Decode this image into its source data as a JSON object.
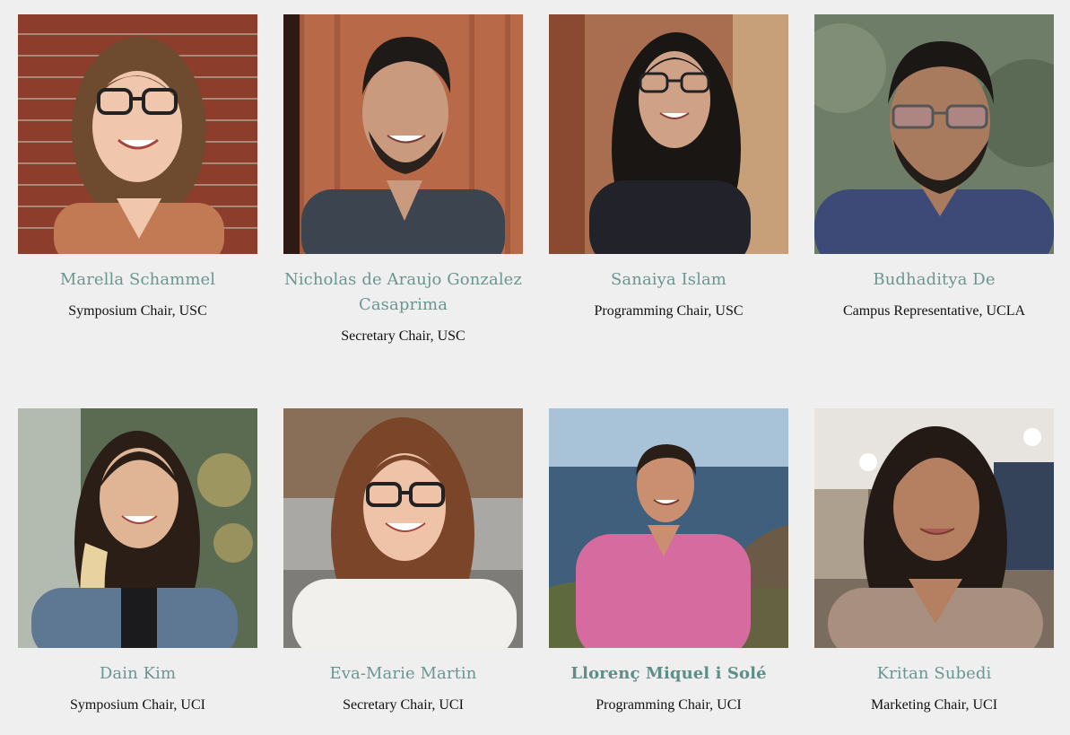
{
  "team": [
    {
      "name": "Marella Schammel",
      "role": "Symposium Chair, USC",
      "photo": "portrait-photo",
      "bg": "#8c3d2c",
      "shirt": "#c27a55",
      "hair": "#6e4a2e",
      "skin": "#f0c6ad"
    },
    {
      "name": "Nicholas de Araujo Gonzalez Casaprima",
      "role": "Secretary Chair, USC",
      "photo": "portrait-photo",
      "bg": "#b86a48",
      "shirt": "#3c4450",
      "hair": "#1e1a17",
      "skin": "#c99a7e"
    },
    {
      "name": "Sanaiya Islam",
      "role": "Programming Chair, USC",
      "photo": "portrait-photo",
      "bg": "#a86e4f",
      "shirt": "#22222a",
      "hair": "#1a1614",
      "skin": "#cfa287"
    },
    {
      "name": "Budhaditya De",
      "role": "Campus Representative, UCLA",
      "photo": "portrait-photo",
      "bg": "#6e7d67",
      "shirt": "#3d4a78",
      "hair": "#1a1714",
      "skin": "#a87a5e"
    },
    {
      "name": "Dain Kim",
      "role": "Symposium Chair, UCI",
      "photo": "portrait-photo",
      "bg": "#5a6b52",
      "shirt": "#5e7894",
      "hair": "#2a1e17",
      "skin": "#e0b596"
    },
    {
      "name": "Eva-Marie Martin",
      "role": "Secretary Chair, UCI",
      "photo": "portrait-photo",
      "bg": "#8a6f58",
      "shirt": "#f2f0ec",
      "hair": "#7a4528",
      "skin": "#efc3a8"
    },
    {
      "name": "Llorenç Miquel i Solé",
      "role": "Programming Chair, UCI",
      "photo": "portrait-photo",
      "bg": "#5d7da3",
      "shirt": "#d56b9e",
      "hair": "#2a1f18",
      "skin": "#c98f70"
    },
    {
      "name": "Kritan Subedi",
      "role": "Marketing Chair, UCI",
      "photo": "portrait-photo",
      "bg": "#7a6c5e",
      "shirt": "#a88f80",
      "hair": "#231a15",
      "skin": "#b57f62"
    }
  ]
}
